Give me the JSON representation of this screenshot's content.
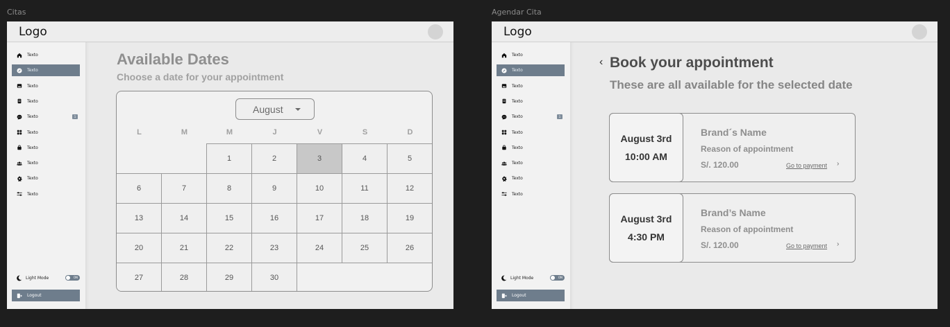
{
  "frames": [
    {
      "label": "Citas",
      "logo": "Logo",
      "sidebar": {
        "items": [
          {
            "label": "Texto",
            "icon": "home-icon"
          },
          {
            "label": "Texto",
            "icon": "edit-icon"
          },
          {
            "label": "Texto",
            "icon": "image-icon"
          },
          {
            "label": "Texto",
            "icon": "document-icon"
          },
          {
            "label": "Texto",
            "icon": "chat-icon",
            "badge": "1"
          },
          {
            "label": "Texto",
            "icon": "grid-icon"
          },
          {
            "label": "Texto",
            "icon": "bag-icon"
          },
          {
            "label": "Texto",
            "icon": "users-icon"
          },
          {
            "label": "Texto",
            "icon": "gear-icon"
          },
          {
            "label": "Texto",
            "icon": "sliders-icon"
          }
        ],
        "active_index": 1,
        "mode_label": "Light Mode",
        "toggle_label": "ON",
        "logout_label": "Logout"
      },
      "main": {
        "title": "Available Dates",
        "subtitle": "Choose a date for your appointment",
        "month": "August",
        "weekdays": [
          "L",
          "M",
          "M",
          "J",
          "V",
          "S",
          "D"
        ],
        "selected_day": "3",
        "weeks": [
          [
            "",
            "",
            "1",
            "2",
            "3",
            "4",
            "5"
          ],
          [
            "6",
            "7",
            "8",
            "9",
            "10",
            "11",
            "12"
          ],
          [
            "13",
            "14",
            "15",
            "16",
            "17",
            "18",
            "19"
          ],
          [
            "20",
            "21",
            "22",
            "23",
            "24",
            "25",
            "26"
          ],
          [
            "27",
            "28",
            "29",
            "30",
            "",
            "",
            ""
          ]
        ]
      }
    },
    {
      "label": "Agendar Cita",
      "logo": "Logo",
      "sidebar": {
        "items": [
          {
            "label": "Texto",
            "icon": "home-icon"
          },
          {
            "label": "Texto",
            "icon": "edit-icon"
          },
          {
            "label": "Texto",
            "icon": "image-icon"
          },
          {
            "label": "Texto",
            "icon": "document-icon"
          },
          {
            "label": "Texto",
            "icon": "chat-icon",
            "badge": "1"
          },
          {
            "label": "Texto",
            "icon": "grid-icon"
          },
          {
            "label": "Texto",
            "icon": "bag-icon"
          },
          {
            "label": "Texto",
            "icon": "users-icon"
          },
          {
            "label": "Texto",
            "icon": "gear-icon"
          },
          {
            "label": "Texto",
            "icon": "sliders-icon"
          }
        ],
        "active_index": 1,
        "mode_label": "Light Mode",
        "toggle_label": "ON",
        "logout_label": "Logout"
      },
      "main": {
        "back_glyph": "‹",
        "title": "Book your appointment",
        "subtitle": "These are all available for the selected date",
        "appointments": [
          {
            "date": "August 3rd",
            "time": "10:00 AM",
            "brand": "Brand´s Name",
            "reason": "Reason of appointment",
            "price": "S/. 120.00",
            "action": "Go to payment"
          },
          {
            "date": "August 3rd",
            "time": "4:30 PM",
            "brand": "Brand’s Name",
            "reason": "Reason of appointment",
            "price": "S/. 120.00",
            "action": "Go to payment"
          }
        ]
      }
    }
  ],
  "colors": {
    "background": "#1e1e1e",
    "accent": "#6e7d8c",
    "selected_cell": "#c8c8c8"
  }
}
